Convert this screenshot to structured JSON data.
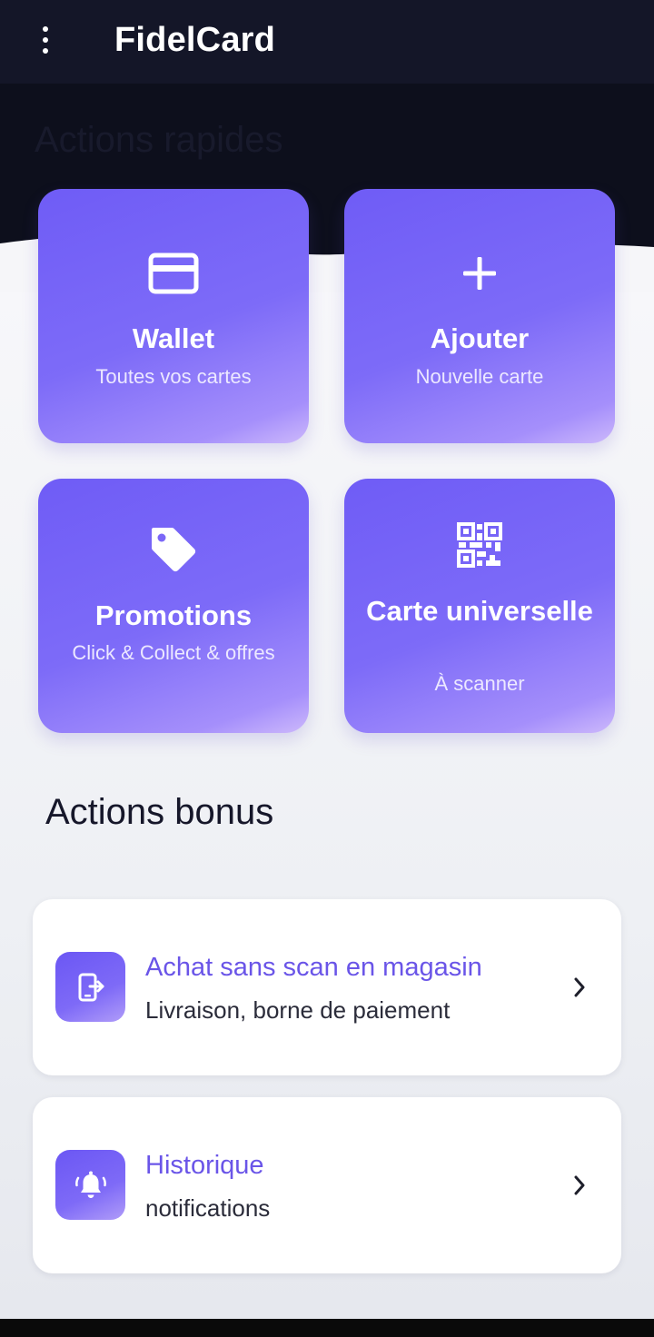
{
  "app": {
    "title": "FidelCard",
    "colors": {
      "app_bar": "#141628",
      "accent": "#6f5cf6",
      "accent_text": "#6a55e8"
    }
  },
  "header": {
    "menu_icon": "more-vertical-icon"
  },
  "quick_actions": {
    "section_title": "Actions rapides",
    "tiles": [
      {
        "icon": "credit-card-icon",
        "title": "Wallet",
        "subtitle": "Toutes vos cartes"
      },
      {
        "icon": "plus-icon",
        "title": "Ajouter",
        "subtitle": "Nouvelle carte"
      },
      {
        "icon": "tag-icon",
        "title": "Promotions",
        "subtitle": "Click & Collect & offres"
      },
      {
        "icon": "qr-code-icon",
        "title": "Carte universelle",
        "subtitle": "À scanner"
      }
    ]
  },
  "bonus_actions": {
    "section_title": "Actions bonus",
    "items": [
      {
        "icon": "phone-exit-icon",
        "title": "Achat sans scan en magasin",
        "subtitle": "Livraison, borne de paiement",
        "chevron": "chevron-right-icon"
      },
      {
        "icon": "bell-ringing-icon",
        "title": "Historique",
        "subtitle": "notifications",
        "chevron": "chevron-right-icon"
      }
    ]
  }
}
